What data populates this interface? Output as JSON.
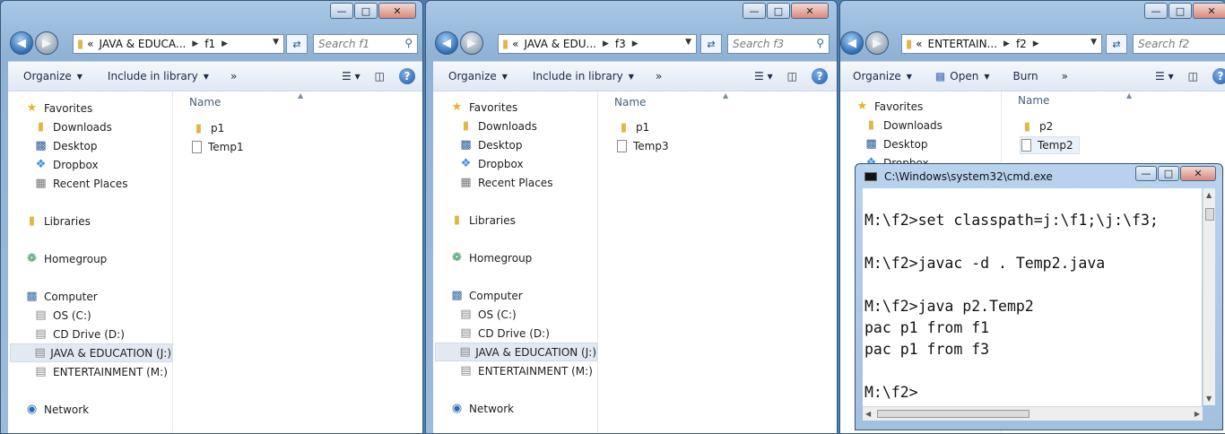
{
  "windows": [
    {
      "breadcrumb": {
        "prefix": "«",
        "drive": "JAVA & EDUCA...",
        "folder": "f1"
      },
      "search_placeholder": "Search f1",
      "toolbar": {
        "organize": "Organize",
        "item2": "Include in library",
        "item3": "",
        "more": "»"
      },
      "nav": {
        "favorites": "Favorites",
        "downloads": "Downloads",
        "desktop": "Desktop",
        "dropbox": "Dropbox",
        "recent": "Recent Places",
        "libraries": "Libraries",
        "homegroup": "Homegroup",
        "computer": "Computer",
        "os": "OS (C:)",
        "cd": "CD Drive (D:)",
        "java": "JAVA & EDUCATION (J:)",
        "ent": "ENTERTAINMENT (M:)",
        "network": "Network"
      },
      "column_name": "Name",
      "files": [
        "p1",
        "Temp1"
      ]
    },
    {
      "breadcrumb": {
        "prefix": "«",
        "drive": "JAVA & EDU...",
        "folder": "f3"
      },
      "search_placeholder": "Search f3",
      "toolbar": {
        "organize": "Organize",
        "item2": "Include in library",
        "item3": "",
        "more": "»"
      },
      "nav": {
        "favorites": "Favorites",
        "downloads": "Downloads",
        "desktop": "Desktop",
        "dropbox": "Dropbox",
        "recent": "Recent Places",
        "libraries": "Libraries",
        "homegroup": "Homegroup",
        "computer": "Computer",
        "os": "OS (C:)",
        "cd": "CD Drive (D:)",
        "java": "JAVA & EDUCATION (J:)",
        "ent": "ENTERTAINMENT (M:)",
        "network": "Network"
      },
      "column_name": "Name",
      "files": [
        "p1",
        "Temp3"
      ]
    },
    {
      "breadcrumb": {
        "prefix": "«",
        "drive": "ENTERTAIN...",
        "folder": "f2"
      },
      "search_placeholder": "Search f2",
      "toolbar": {
        "organize": "Organize",
        "item2": "Open",
        "item3": "Burn",
        "more": "»"
      },
      "nav": {
        "favorites": "Favorites",
        "downloads": "Downloads",
        "desktop": "Desktop",
        "dropbox": "Dropbox"
      },
      "column_name": "Name",
      "files": [
        "p2",
        "Temp2"
      ]
    }
  ],
  "cmd": {
    "title": "C:\\Windows\\system32\\cmd.exe",
    "lines": [
      "M:\\f2>set classpath=j:\\f1;\\j:\\f3;",
      "",
      "M:\\f2>javac -d . Temp2.java",
      "",
      "M:\\f2>java p2.Temp2",
      "pac p1 from f1",
      "pac p1 from f3",
      "",
      "M:\\f2>"
    ]
  }
}
